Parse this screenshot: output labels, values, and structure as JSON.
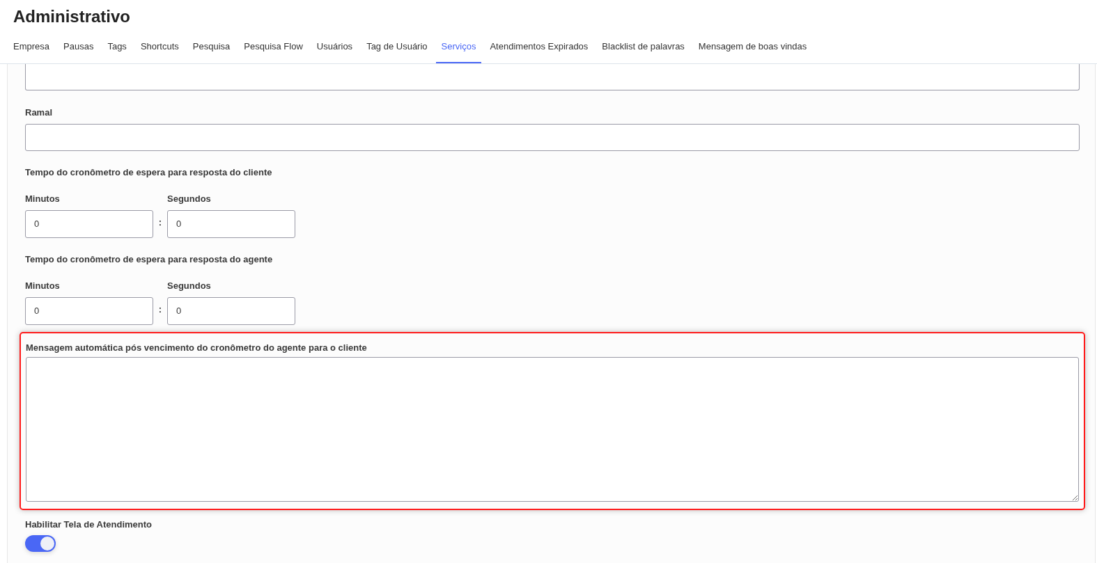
{
  "title": "Administrativo",
  "tabs": [
    {
      "label": "Empresa",
      "selected": false
    },
    {
      "label": "Pausas",
      "selected": false
    },
    {
      "label": "Tags",
      "selected": false
    },
    {
      "label": "Shortcuts",
      "selected": false
    },
    {
      "label": "Pesquisa",
      "selected": false
    },
    {
      "label": "Pesquisa Flow",
      "selected": false
    },
    {
      "label": "Usuários",
      "selected": false
    },
    {
      "label": "Tag de Usuário",
      "selected": false
    },
    {
      "label": "Serviços",
      "selected": true
    },
    {
      "label": "Atendimentos Expirados",
      "selected": false
    },
    {
      "label": "Blacklist de palavras",
      "selected": false
    },
    {
      "label": "Mensagem de boas vindas",
      "selected": false
    }
  ],
  "ramal": {
    "label": "Ramal"
  },
  "timers": [
    {
      "heading": "Tempo do cronômetro de espera para resposta do cliente",
      "minutes": {
        "label": "Minutos",
        "value": "0"
      },
      "separator": ":",
      "seconds": {
        "label": "Segundos",
        "value": "0"
      }
    },
    {
      "heading": "Tempo do cronômetro de espera para resposta do agente",
      "minutes": {
        "label": "Minutos",
        "value": "0"
      },
      "separator": ":",
      "seconds": {
        "label": "Segundos",
        "value": "0"
      }
    }
  ],
  "message": {
    "label": "Mensagem automática pós vencimento do cronômetro do agente para o cliente",
    "highlighted": true
  },
  "toggle": {
    "label": "Habilitar Tela de Atendimento",
    "on": true
  }
}
